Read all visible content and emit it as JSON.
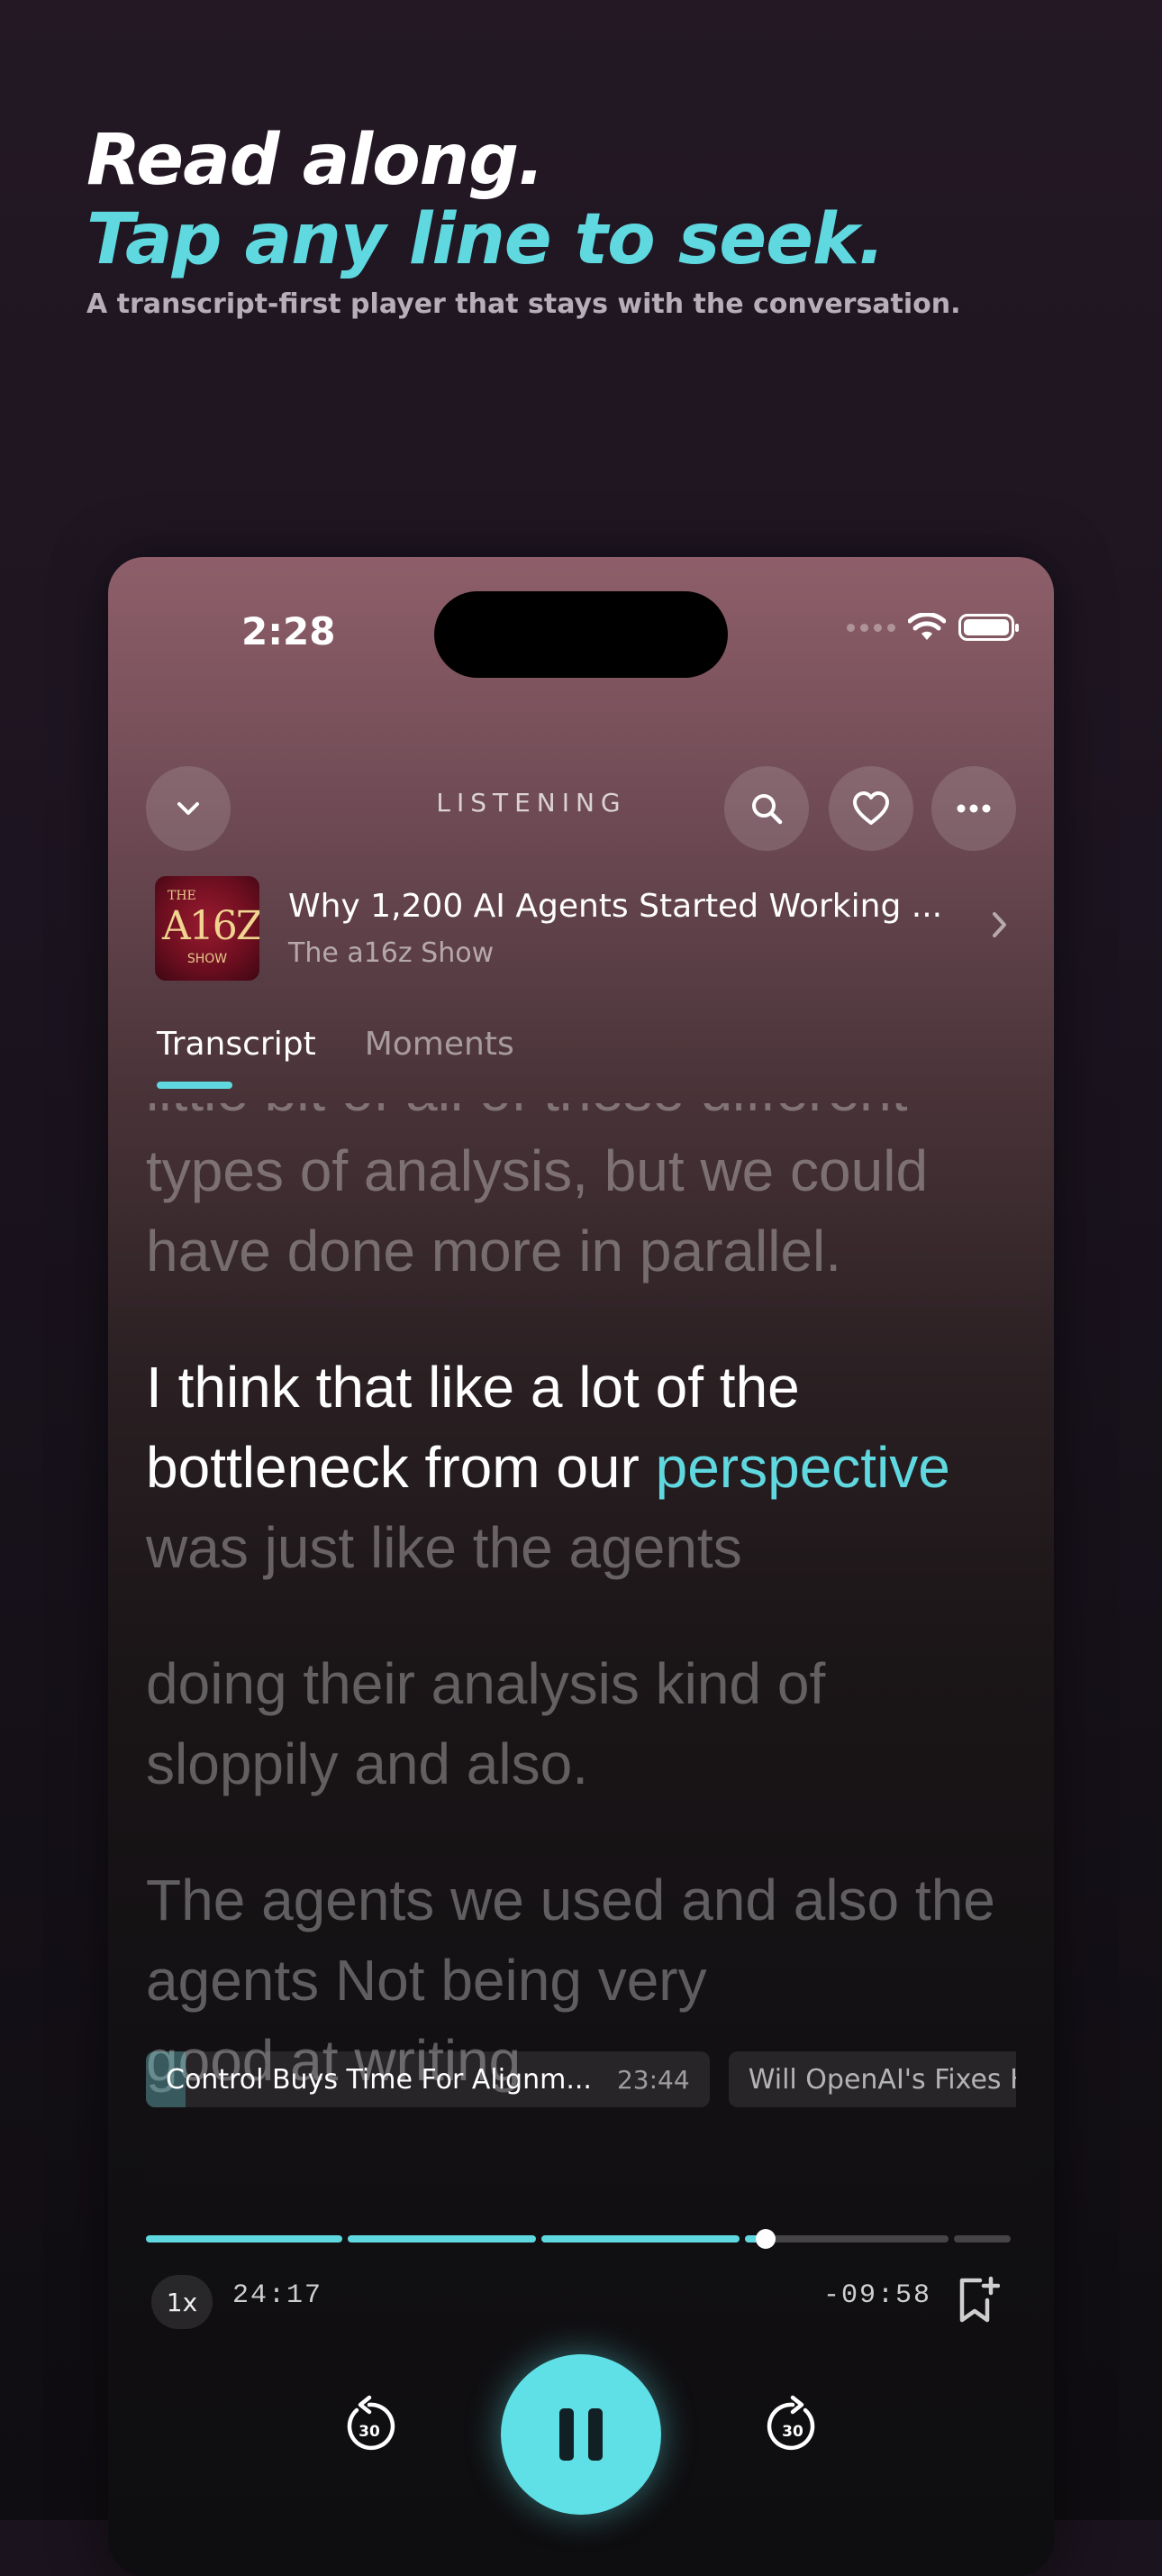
{
  "hero": {
    "line1": "Read along.",
    "line2": "Tap any line to seek.",
    "subtitle": "A transcript-first player that stays with the conversation."
  },
  "status_bar": {
    "time": "2:28"
  },
  "header": {
    "label": "LISTENING",
    "collapse_icon": "chevron-down-icon",
    "search_icon": "search-icon",
    "favorite_icon": "heart-icon",
    "more_icon": "ellipsis-icon"
  },
  "episode": {
    "title": "Why 1,200 AI Agents Started Working ...",
    "show": "The a16z Show",
    "artwork": {
      "the": "THE",
      "main": "A16Z",
      "show": "SHOW"
    }
  },
  "tabs": [
    {
      "label": "Transcript",
      "active": true
    },
    {
      "label": "Moments",
      "active": false
    }
  ],
  "transcript": {
    "previous_cut": "little bit of all of these different",
    "previous": "types of analysis, but we could have done more in parallel.",
    "current_spoken": "I think that like a lot of the bottleneck from our",
    "current_word": "perspective",
    "current_rest": " was just like the agents",
    "next_1": "doing their analysis kind of sloppily and also.",
    "next_2": "The agents we used and also the agents Not being very",
    "next_2_cut": "good at writing"
  },
  "chapters": [
    {
      "title": "Control Buys Time For Alignm...",
      "time": "23:44",
      "active": true
    },
    {
      "title": "Will OpenAI's Fixes Hol",
      "time": "",
      "active": false
    }
  ],
  "playback": {
    "speed": "1x",
    "elapsed": "24:17",
    "remaining": "-09:58",
    "progress_fraction": 0.712,
    "chapter_segments_fraction": [
      0.232,
      0.222,
      0.234,
      0.241,
      0.071
    ],
    "skip_back_seconds": "30",
    "skip_forward_seconds": "30"
  },
  "colors": {
    "accent": "#5fd8df",
    "play_button": "#5fe0e6",
    "background": "#1b131d"
  }
}
